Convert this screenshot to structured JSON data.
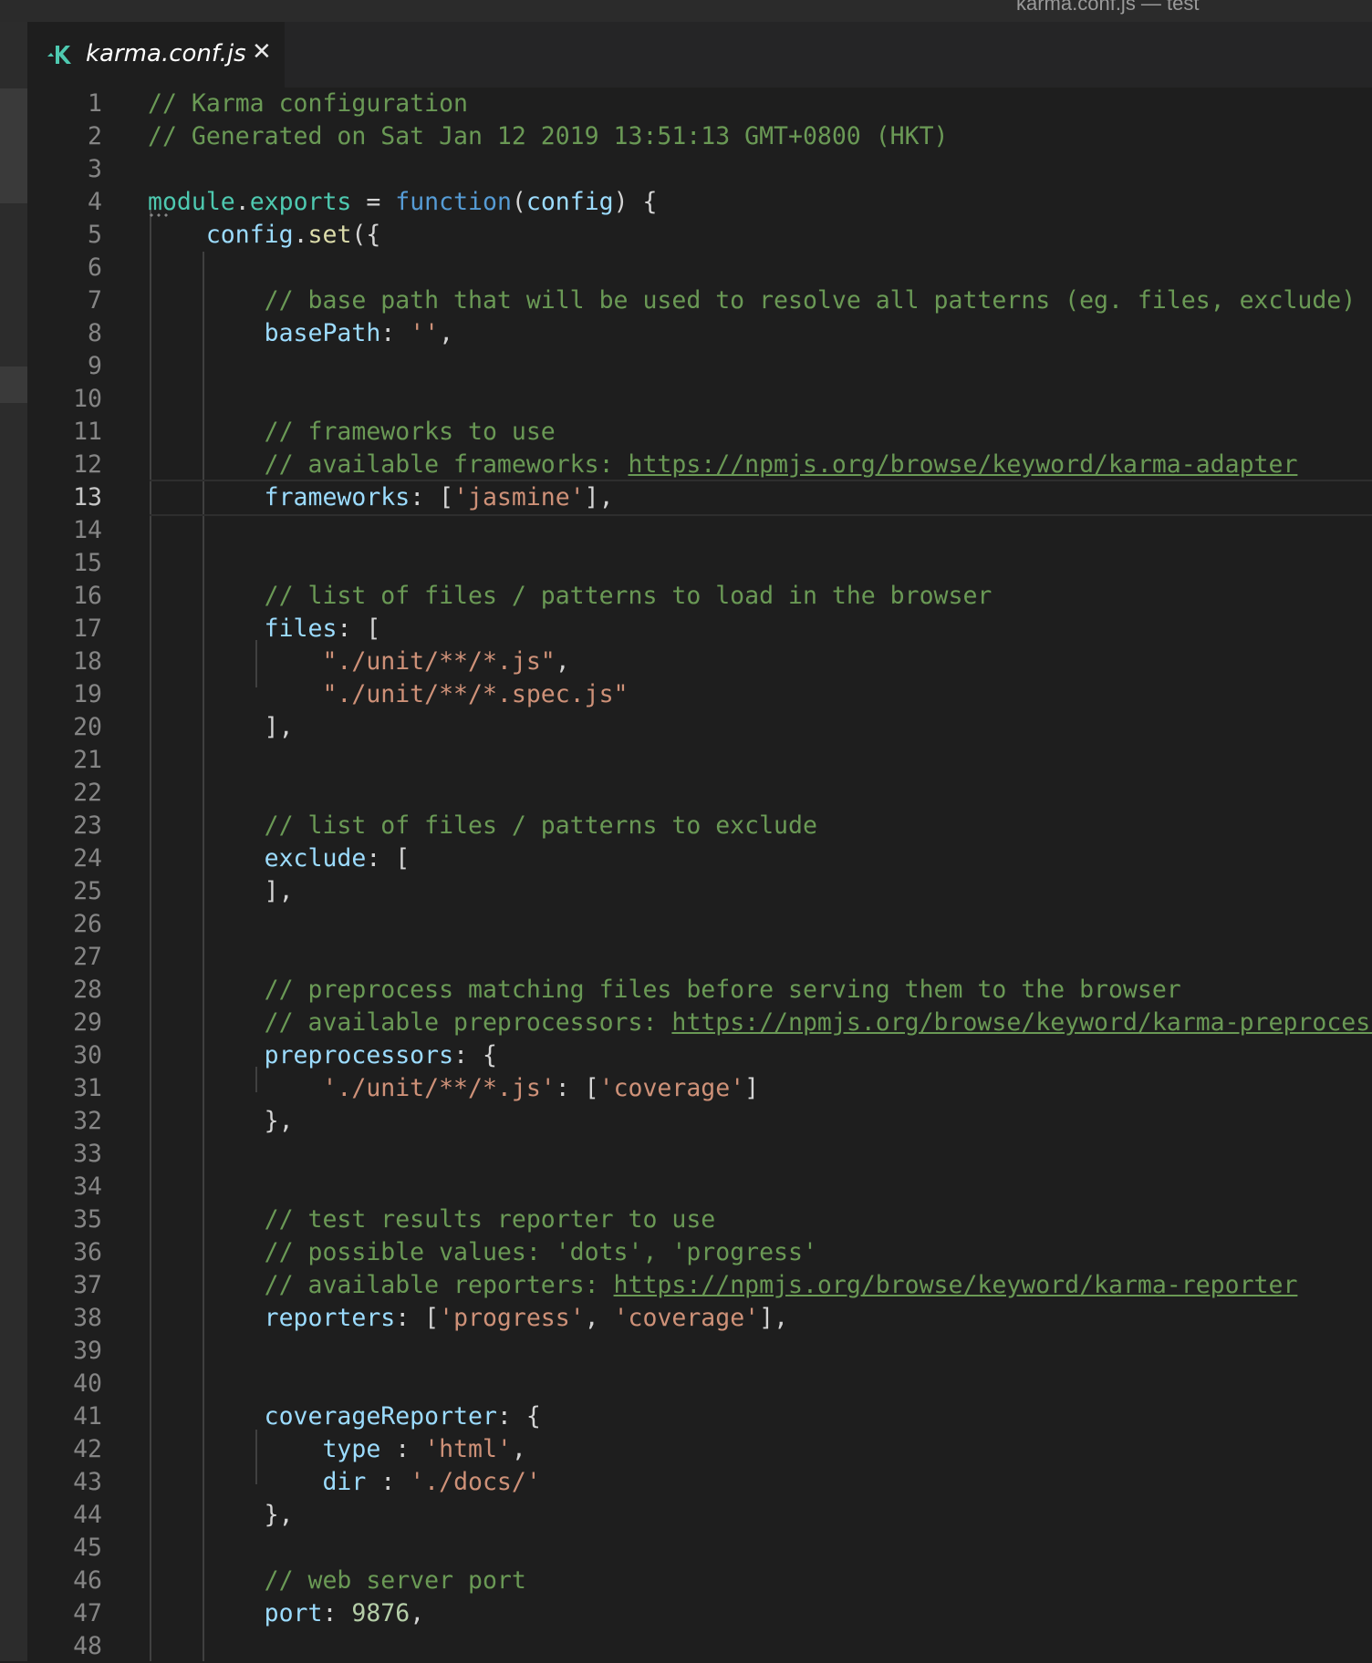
{
  "window": {
    "title": "karma.conf.js — test"
  },
  "tab": {
    "label": "karma.conf.js",
    "close_glyph": "✕",
    "icon": "karma-icon",
    "icon_color": "#4ec9b0"
  },
  "editor": {
    "active_line": 13,
    "lines": [
      {
        "num": "1",
        "tokens": [
          [
            "c-com",
            "// Karma configuration"
          ]
        ]
      },
      {
        "num": "2",
        "tokens": [
          [
            "c-com",
            "// Generated on Sat Jan 12 2019 13:51:13 GMT+0800 (HKT)"
          ]
        ]
      },
      {
        "num": "3",
        "tokens": []
      },
      {
        "num": "4",
        "tokens": [
          [
            "c-mod",
            "module"
          ],
          [
            "c-punc",
            "."
          ],
          [
            "c-mod",
            "exports"
          ],
          [
            "c-punc",
            " = "
          ],
          [
            "c-kw",
            "function"
          ],
          [
            "c-punc",
            "("
          ],
          [
            "c-var",
            "config"
          ],
          [
            "c-punc",
            ") {"
          ]
        ]
      },
      {
        "num": "5",
        "tokens": [
          [
            "c-punc",
            "    "
          ],
          [
            "c-var",
            "config"
          ],
          [
            "c-punc",
            "."
          ],
          [
            "c-fn",
            "set"
          ],
          [
            "c-punc",
            "({"
          ]
        ]
      },
      {
        "num": "6",
        "tokens": []
      },
      {
        "num": "7",
        "tokens": [
          [
            "c-punc",
            "        "
          ],
          [
            "c-com",
            "// base path that will be used to resolve all patterns (eg. files, exclude)"
          ]
        ]
      },
      {
        "num": "8",
        "tokens": [
          [
            "c-punc",
            "        "
          ],
          [
            "c-var",
            "basePath"
          ],
          [
            "c-punc",
            ": "
          ],
          [
            "c-str",
            "''"
          ],
          [
            "c-punc",
            ","
          ]
        ]
      },
      {
        "num": "9",
        "tokens": []
      },
      {
        "num": "10",
        "tokens": []
      },
      {
        "num": "11",
        "tokens": [
          [
            "c-punc",
            "        "
          ],
          [
            "c-com",
            "// frameworks to use"
          ]
        ]
      },
      {
        "num": "12",
        "tokens": [
          [
            "c-punc",
            "        "
          ],
          [
            "c-com",
            "// available frameworks: "
          ],
          [
            "c-link",
            "https://npmjs.org/browse/keyword/karma-adapter"
          ]
        ]
      },
      {
        "num": "13",
        "tokens": [
          [
            "c-punc",
            "        "
          ],
          [
            "c-var",
            "frameworks"
          ],
          [
            "c-punc",
            ": ["
          ],
          [
            "c-str",
            "'jasmine'"
          ],
          [
            "c-punc",
            "],"
          ]
        ]
      },
      {
        "num": "14",
        "tokens": []
      },
      {
        "num": "15",
        "tokens": []
      },
      {
        "num": "16",
        "tokens": [
          [
            "c-punc",
            "        "
          ],
          [
            "c-com",
            "// list of files / patterns to load in the browser"
          ]
        ]
      },
      {
        "num": "17",
        "tokens": [
          [
            "c-punc",
            "        "
          ],
          [
            "c-var",
            "files"
          ],
          [
            "c-punc",
            ": ["
          ]
        ]
      },
      {
        "num": "18",
        "tokens": [
          [
            "c-punc",
            "            "
          ],
          [
            "c-str",
            "\"./unit/**/*.js\""
          ],
          [
            "c-punc",
            ","
          ]
        ]
      },
      {
        "num": "19",
        "tokens": [
          [
            "c-punc",
            "            "
          ],
          [
            "c-str",
            "\"./unit/**/*.spec.js\""
          ]
        ]
      },
      {
        "num": "20",
        "tokens": [
          [
            "c-punc",
            "        ],"
          ]
        ]
      },
      {
        "num": "21",
        "tokens": []
      },
      {
        "num": "22",
        "tokens": []
      },
      {
        "num": "23",
        "tokens": [
          [
            "c-punc",
            "        "
          ],
          [
            "c-com",
            "// list of files / patterns to exclude"
          ]
        ]
      },
      {
        "num": "24",
        "tokens": [
          [
            "c-punc",
            "        "
          ],
          [
            "c-var",
            "exclude"
          ],
          [
            "c-punc",
            ": ["
          ]
        ]
      },
      {
        "num": "25",
        "tokens": [
          [
            "c-punc",
            "        ],"
          ]
        ]
      },
      {
        "num": "26",
        "tokens": []
      },
      {
        "num": "27",
        "tokens": []
      },
      {
        "num": "28",
        "tokens": [
          [
            "c-punc",
            "        "
          ],
          [
            "c-com",
            "// preprocess matching files before serving them to the browser"
          ]
        ]
      },
      {
        "num": "29",
        "tokens": [
          [
            "c-punc",
            "        "
          ],
          [
            "c-com",
            "// available preprocessors: "
          ],
          [
            "c-link",
            "https://npmjs.org/browse/keyword/karma-preprocessor"
          ]
        ]
      },
      {
        "num": "30",
        "tokens": [
          [
            "c-punc",
            "        "
          ],
          [
            "c-var",
            "preprocessors"
          ],
          [
            "c-punc",
            ": {"
          ]
        ]
      },
      {
        "num": "31",
        "tokens": [
          [
            "c-punc",
            "            "
          ],
          [
            "c-str",
            "'./unit/**/*.js'"
          ],
          [
            "c-punc",
            ": ["
          ],
          [
            "c-str",
            "'coverage'"
          ],
          [
            "c-punc",
            "]"
          ]
        ]
      },
      {
        "num": "32",
        "tokens": [
          [
            "c-punc",
            "        },"
          ]
        ]
      },
      {
        "num": "33",
        "tokens": []
      },
      {
        "num": "34",
        "tokens": []
      },
      {
        "num": "35",
        "tokens": [
          [
            "c-punc",
            "        "
          ],
          [
            "c-com",
            "// test results reporter to use"
          ]
        ]
      },
      {
        "num": "36",
        "tokens": [
          [
            "c-punc",
            "        "
          ],
          [
            "c-com",
            "// possible values: 'dots', 'progress'"
          ]
        ]
      },
      {
        "num": "37",
        "tokens": [
          [
            "c-punc",
            "        "
          ],
          [
            "c-com",
            "// available reporters: "
          ],
          [
            "c-link",
            "https://npmjs.org/browse/keyword/karma-reporter"
          ]
        ]
      },
      {
        "num": "38",
        "tokens": [
          [
            "c-punc",
            "        "
          ],
          [
            "c-var",
            "reporters"
          ],
          [
            "c-punc",
            ": ["
          ],
          [
            "c-str",
            "'progress'"
          ],
          [
            "c-punc",
            ", "
          ],
          [
            "c-str",
            "'coverage'"
          ],
          [
            "c-punc",
            "],"
          ]
        ]
      },
      {
        "num": "39",
        "tokens": []
      },
      {
        "num": "40",
        "tokens": []
      },
      {
        "num": "41",
        "tokens": [
          [
            "c-punc",
            "        "
          ],
          [
            "c-var",
            "coverageReporter"
          ],
          [
            "c-punc",
            ": {"
          ]
        ]
      },
      {
        "num": "42",
        "tokens": [
          [
            "c-punc",
            "            "
          ],
          [
            "c-var",
            "type"
          ],
          [
            "c-punc",
            " : "
          ],
          [
            "c-str",
            "'html'"
          ],
          [
            "c-punc",
            ","
          ]
        ]
      },
      {
        "num": "43",
        "tokens": [
          [
            "c-punc",
            "            "
          ],
          [
            "c-var",
            "dir"
          ],
          [
            "c-punc",
            " : "
          ],
          [
            "c-str",
            "'./docs/'"
          ]
        ]
      },
      {
        "num": "44",
        "tokens": [
          [
            "c-punc",
            "        },"
          ]
        ]
      },
      {
        "num": "45",
        "tokens": []
      },
      {
        "num": "46",
        "tokens": [
          [
            "c-punc",
            "        "
          ],
          [
            "c-com",
            "// web server port"
          ]
        ]
      },
      {
        "num": "47",
        "tokens": [
          [
            "c-punc",
            "        "
          ],
          [
            "c-var",
            "port"
          ],
          [
            "c-punc",
            ": "
          ],
          [
            "c-num",
            "9876"
          ],
          [
            "c-punc",
            ","
          ]
        ]
      },
      {
        "num": "48",
        "tokens": []
      }
    ]
  }
}
